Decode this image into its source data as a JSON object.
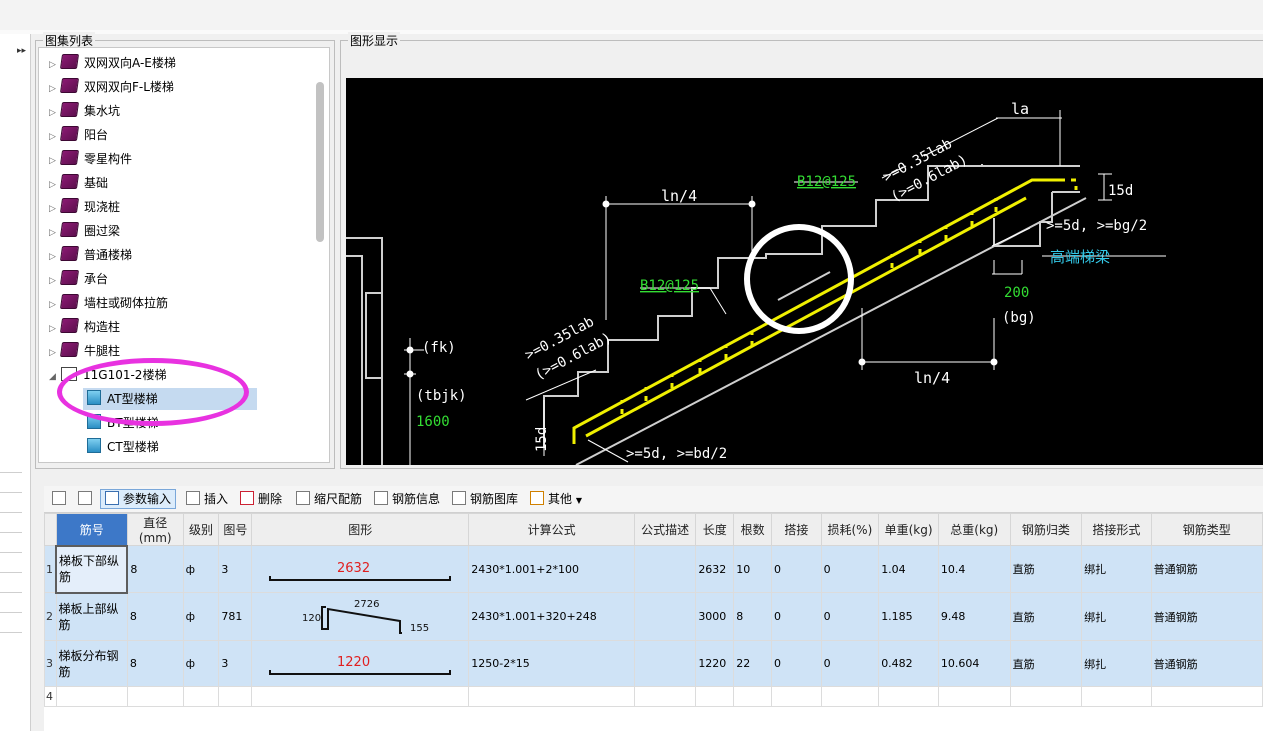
{
  "panels": {
    "atlas_title": "图集列表",
    "graphic_title": "图形显示"
  },
  "tree": {
    "items": [
      {
        "label": "双网双向A-E楼梯",
        "type": "book"
      },
      {
        "label": "双网双向F-L楼梯",
        "type": "book"
      },
      {
        "label": "集水坑",
        "type": "book"
      },
      {
        "label": "阳台",
        "type": "book"
      },
      {
        "label": "零星构件",
        "type": "book"
      },
      {
        "label": "基础",
        "type": "book"
      },
      {
        "label": "现浇桩",
        "type": "book"
      },
      {
        "label": "圈过梁",
        "type": "book"
      },
      {
        "label": "普通楼梯",
        "type": "book"
      },
      {
        "label": "承台",
        "type": "book"
      },
      {
        "label": "墙柱或砌体拉筋",
        "type": "book"
      },
      {
        "label": "构造柱",
        "type": "book"
      },
      {
        "label": "牛腿柱",
        "type": "book"
      },
      {
        "label": "11G101-2楼梯",
        "type": "folder-open"
      }
    ],
    "children": [
      {
        "label": "AT型楼梯",
        "selected": true
      },
      {
        "label": "BT型楼梯",
        "selected": false
      },
      {
        "label": "CT型楼梯",
        "selected": false
      }
    ]
  },
  "drawing": {
    "la": "la",
    "ln4_top": "ln/4",
    "ln4_bottom": "ln/4",
    "b12_upper": "B12@125",
    "b12_lower": "B12@125",
    "anchor_upper_1": ">=0.35lab",
    "anchor_upper_2": "(>=0.6lab)",
    "anchor_lower_1": ">=0.35lab",
    "anchor_lower_2": "(>=0.6lab)",
    "d15_right": "15d",
    "d15_left": "15d",
    "ge5d_top": ">=5d, >=bg/2",
    "ge5d_bottom": ">=5d, >=bd/2",
    "high_beam": "高端梯梁",
    "v200": "200",
    "bg": "(bg)",
    "fk": "(fk)",
    "tbjk": "(tbjk)",
    "v1600": "1600"
  },
  "toolbar": {
    "param_input": "参数输入",
    "insert": "插入",
    "delete": "删除",
    "scale_rebar": "缩尺配筋",
    "rebar_info": "钢筋信息",
    "rebar_lib": "钢筋图库",
    "other": "其他"
  },
  "table": {
    "headers": [
      "筋号",
      "直径(mm)",
      "级别",
      "图号",
      "图形",
      "计算公式",
      "公式描述",
      "长度",
      "根数",
      "搭接",
      "损耗(%)",
      "单重(kg)",
      "总重(kg)",
      "钢筋归类",
      "搭接形式",
      "钢筋类型"
    ],
    "rows": [
      {
        "no": "1",
        "name": "梯板下部纵筋",
        "dia": "8",
        "grade": "ф",
        "fig": "3",
        "shape_value": "2632",
        "formula": "2430*1.001+2*100",
        "desc": "",
        "len": "2632",
        "count": "10",
        "lap": "0",
        "loss": "0",
        "unit": "1.04",
        "total": "10.4",
        "cat": "直筋",
        "lapform": "绑扎",
        "type": "普通钢筋"
      },
      {
        "no": "2",
        "name": "梯板上部纵筋",
        "dia": "8",
        "grade": "ф",
        "fig": "781",
        "shape_value": "2726",
        "shape_left": "120",
        "shape_right": "155",
        "formula": "2430*1.001+320+248",
        "desc": "",
        "len": "3000",
        "count": "8",
        "lap": "0",
        "loss": "0",
        "unit": "1.185",
        "total": "9.48",
        "cat": "直筋",
        "lapform": "绑扎",
        "type": "普通钢筋"
      },
      {
        "no": "3",
        "name": "梯板分布钢筋",
        "dia": "8",
        "grade": "ф",
        "fig": "3",
        "shape_value": "1220",
        "formula": "1250-2*15",
        "desc": "",
        "len": "1220",
        "count": "22",
        "lap": "0",
        "loss": "0",
        "unit": "0.482",
        "total": "10.604",
        "cat": "直筋",
        "lapform": "绑扎",
        "type": "普通钢筋"
      }
    ],
    "empty_row_no": "4"
  },
  "colors": {
    "rebar": "#f0f000",
    "label_green": "#33dd33",
    "label_cyan": "#33c9e8",
    "highlight_pink": "#e832e0",
    "selection_blue": "#c5daf0",
    "row_blue": "#cfe3f6"
  }
}
